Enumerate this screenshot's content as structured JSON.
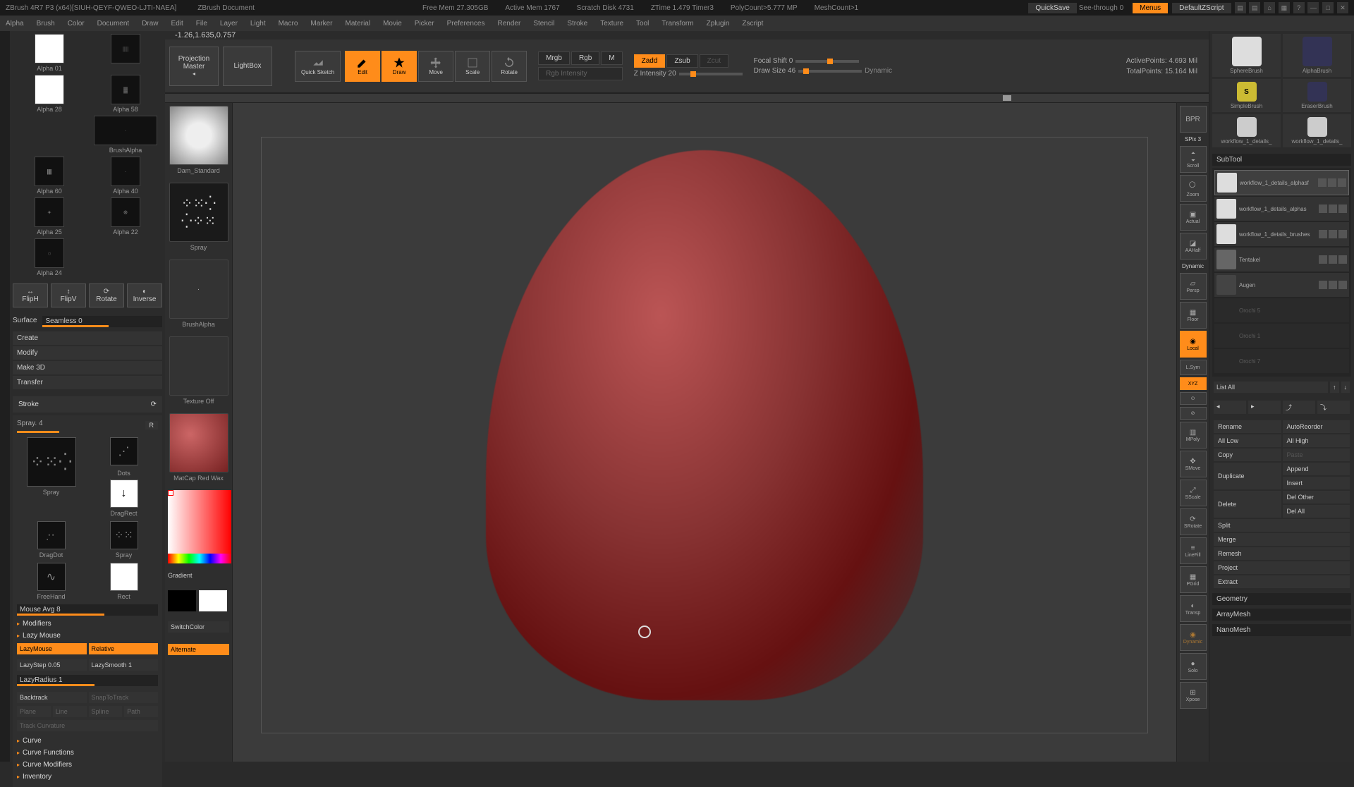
{
  "titlebar": {
    "app": "ZBrush 4R7 P3 (x64)[SIUH-QEYF-QWEO-LJTI-NAEA]",
    "doc": "ZBrush Document",
    "free_mem": "Free Mem 27.305GB",
    "active_mem": "Active Mem 1767",
    "scratch": "Scratch Disk 4731",
    "ztime": "ZTime 1.479 Timer3",
    "polycount": "PolyCount>5.777 MP",
    "meshcount": "MeshCount>1",
    "quicksave": "QuickSave",
    "seethrough": "See-through  0",
    "menus": "Menus",
    "script": "DefaultZScript"
  },
  "menu": [
    "Alpha",
    "Brush",
    "Color",
    "Document",
    "Draw",
    "Edit",
    "File",
    "Layer",
    "Light",
    "Macro",
    "Marker",
    "Material",
    "Movie",
    "Picker",
    "Preferences",
    "Render",
    "Stencil",
    "Stroke",
    "Texture",
    "Tool",
    "Transform",
    "Zplugin",
    "Zscript"
  ],
  "coords": "-1.26,1.635,0.757",
  "toolshelf": {
    "projection": "Projection Master",
    "lightbox": "LightBox",
    "quicksketch": "Quick Sketch",
    "edit": "Edit",
    "draw": "Draw",
    "move": "Move",
    "scale": "Scale",
    "rotate": "Rotate",
    "mrgb": "Mrgb",
    "rgb": "Rgb",
    "m": "M",
    "rgb_int": "Rgb Intensity",
    "zadd": "Zadd",
    "zsub": "Zsub",
    "zcut": "Zcut",
    "zint": "Z Intensity 20",
    "focal": "Focal Shift 0",
    "drawsize": "Draw Size 46",
    "dynamic": "Dynamic",
    "active_pts": "ActivePoints: 4.693 Mil",
    "total_pts": "TotalPoints: 15.164 Mil"
  },
  "alphas": [
    {
      "l": "Alpha 01",
      "r": ""
    },
    {
      "l": "Alpha 28",
      "r": "Alpha 58"
    },
    {
      "l": "",
      "r": "BrushAlpha",
      "wide": true
    },
    {
      "l": "Alpha 60",
      "r": "Alpha 40"
    },
    {
      "l": "Alpha 25",
      "r": "Alpha 22"
    },
    {
      "l": "Alpha 24",
      "r": ""
    }
  ],
  "surface": {
    "flipH": "FlipH",
    "flipV": "FlipV",
    "rotate": "Rotate",
    "inverse": "Inverse",
    "label": "Surface",
    "seamless": "Seamless 0",
    "create": "Create",
    "modify": "Modify",
    "make3d": "Make 3D",
    "transfer": "Transfer"
  },
  "stroke": {
    "title": "Stroke",
    "spray": "Spray. 4",
    "r": "R",
    "stroke1": "Spray",
    "stroke2": "Dots",
    "dragdot": "DragDot",
    "spray2": "DragRect",
    "freehand": "FreeHand",
    "rect": "Rect",
    "mouseavg": "Mouse Avg 8",
    "modifiers": "Modifiers",
    "lazymouse": "Lazy Mouse",
    "lm_on": "LazyMouse",
    "relative": "Relative",
    "lazystep": "LazyStep 0.05",
    "lazysmooth": "LazySmooth 1",
    "lazyradius": "LazyRadius 1",
    "backtrack": "Backtrack",
    "snap": "SnapToTrack",
    "plane": "Plane",
    "line": "Line",
    "spline": "Spline",
    "path": "Path",
    "trackcurv": "Track Curvature",
    "curve": "Curve",
    "curvefn": "Curve Functions",
    "curvemod": "Curve Modifiers",
    "inventory": "Inventory"
  },
  "brushcol": {
    "b1": "Dam_Standard",
    "b2": "Spray",
    "b3": "BrushAlpha",
    "b4": "Texture Off",
    "b5": "MatCap Red Wax",
    "gradient": "Gradient",
    "switchcolor": "SwitchColor",
    "alternate": "Alternate"
  },
  "right_icons": [
    "BPR",
    "SPix 3",
    "Scroll",
    "Zoom",
    "Actual",
    "AAHalf",
    "Dynamic",
    "Persp",
    "",
    "Floor",
    "Local",
    "",
    "L.Sym",
    "XYZ",
    "",
    "",
    "MPoly",
    "SMove",
    "SScale",
    "SRotate",
    "LineFill",
    "PGrid",
    "Transp",
    "Dynamic",
    "Solo",
    "Xpose"
  ],
  "subtool": {
    "hdr": "SubTool",
    "items": [
      {
        "name": "workflow_1_details_alphasf",
        "active": true
      },
      {
        "name": "workflow_1_details_alphas"
      },
      {
        "name": "workflow_1_details_brushes"
      },
      {
        "name": "Tentakel"
      },
      {
        "name": "Augen"
      },
      {
        "name": "Orochi 5",
        "dim": true
      },
      {
        "name": "Orochi 1",
        "dim": true
      },
      {
        "name": "Orochi 7",
        "dim": true
      }
    ],
    "listall": "List All",
    "buttons": [
      "Rename",
      "AutoReorder",
      "All Low",
      "All High",
      "Copy",
      "Paste",
      "Duplicate",
      "Append",
      "",
      "Insert",
      "Delete",
      "Del Other",
      "",
      "Del All",
      "Split",
      "",
      "Merge",
      "",
      "Remesh",
      "",
      "Project",
      "",
      "Extract",
      ""
    ],
    "sections": [
      "Geometry",
      "ArrayMesh",
      "NanoMesh"
    ]
  },
  "tools": [
    {
      "name": "SphereBrush"
    },
    {
      "name": "AlphaBrush"
    },
    {
      "name": "SimpleBrush"
    },
    {
      "name": "EraserBrush"
    },
    {
      "name": "workflow_1_details_"
    },
    {
      "name": "workflow_1_details_"
    }
  ]
}
